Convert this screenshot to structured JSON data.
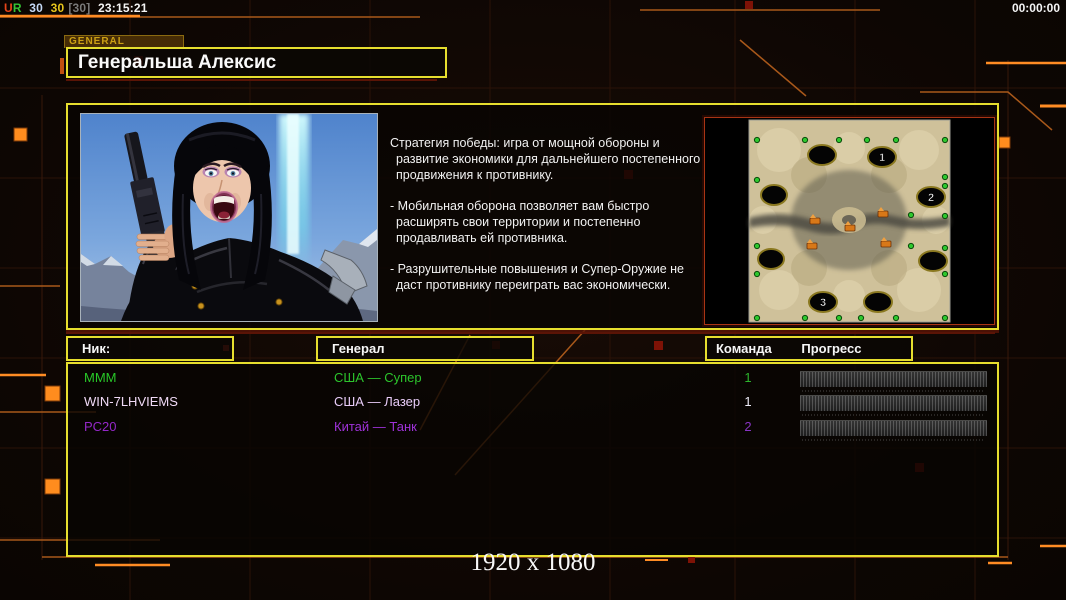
{
  "status_bar": {
    "segments": [
      {
        "text": "U",
        "color": "#e84418"
      },
      {
        "text": "R",
        "color": "#34c434"
      },
      {
        "text": "30",
        "color": "#c6d9f6"
      },
      {
        "text": "30",
        "color": "#e8c61c"
      },
      {
        "text": "[30]",
        "color": "#7a7a7a"
      },
      {
        "text": "23:15:21",
        "color": "#f4f4f4"
      }
    ],
    "timer": "00:00:00"
  },
  "general_tab": {
    "label": "GENERAL"
  },
  "header": {
    "title": "Генеральша Алексис"
  },
  "strategy": {
    "paragraphs": [
      "Стратегия победы: игра от мощной обороны и развитие экономики для дальнейшего постепенного продвижения к противнику.",
      "- Мобильная оборона позволяет вам быстро расширять свои территории и постепенно продавливать ей противника.",
      "- Разрушительные повышения и Супер-Оружие не даст противнику переиграть вас экономически."
    ]
  },
  "map_preview": {
    "markers": [
      "1",
      "2",
      "3"
    ]
  },
  "players_table": {
    "headers": {
      "nick": "Ник:",
      "general": "Генерал",
      "team": "Команда",
      "progress": "Прогресс"
    },
    "rows": [
      {
        "nick": "MMM",
        "general": "США — Супер",
        "team": "1",
        "nick_color": "#28c828",
        "general_color": "#2cc42c",
        "team_color": "#2cb42c"
      },
      {
        "nick": "WIN-7LHVIEMS",
        "general": "США — Лазер",
        "team": "1",
        "nick_color": "#f0daf6",
        "general_color": "#e8ccf8",
        "team_color": "#ecebf6"
      },
      {
        "nick": "PC20",
        "general": "Китай — Танк",
        "team": "2",
        "nick_color": "#9428c8",
        "general_color": "#9e32d8",
        "team_color": "#8834c4"
      }
    ]
  },
  "footer": {
    "resolution": "1920 x 1080"
  },
  "colors": {
    "panel_border": "#e6de2e",
    "accent_orange": "#ff8c1e",
    "map_border": "#a83414"
  }
}
